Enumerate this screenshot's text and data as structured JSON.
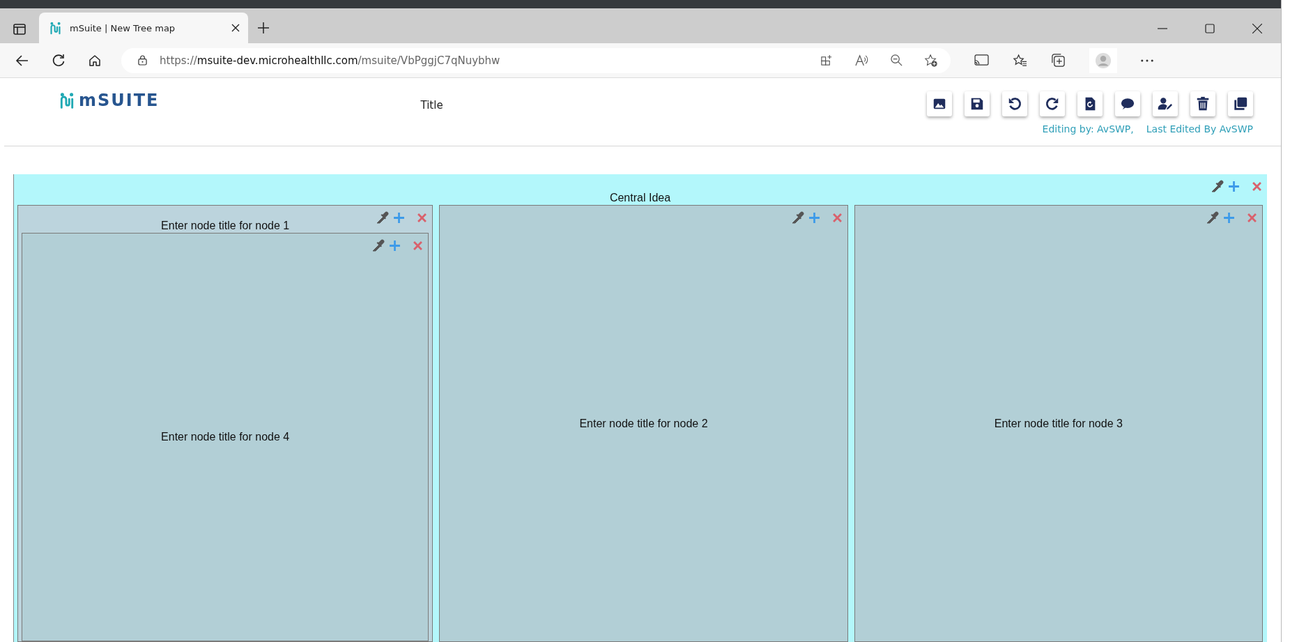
{
  "browser": {
    "tab": {
      "title": "mSuite | New Tree map",
      "selected": true
    },
    "url": {
      "scheme": "https://",
      "host": "msuite-dev.microhealthllc.com",
      "path": "/msuite/VbPggjC7qNuybhw"
    }
  },
  "header": {
    "logo": "mSUITE",
    "title": "Title",
    "toolbar": [
      {
        "kind": "image"
      },
      {
        "kind": "save"
      },
      {
        "kind": "undo"
      },
      {
        "kind": "redo"
      },
      {
        "kind": "restore"
      },
      {
        "kind": "comment"
      },
      {
        "kind": "user-edit"
      },
      {
        "kind": "delete"
      },
      {
        "kind": "copy"
      }
    ],
    "editing_by": "Editing by: AvSWP,",
    "last_edited": "Last Edited By AvSWP"
  },
  "map": {
    "title": "Central Idea",
    "children": [
      {
        "title": "Enter node title for node 1",
        "children": [
          {
            "title": "Enter node title for node 4"
          }
        ]
      },
      {
        "title": "Enter node title for node 2"
      },
      {
        "title": "Enter node title for node 3"
      }
    ]
  }
}
